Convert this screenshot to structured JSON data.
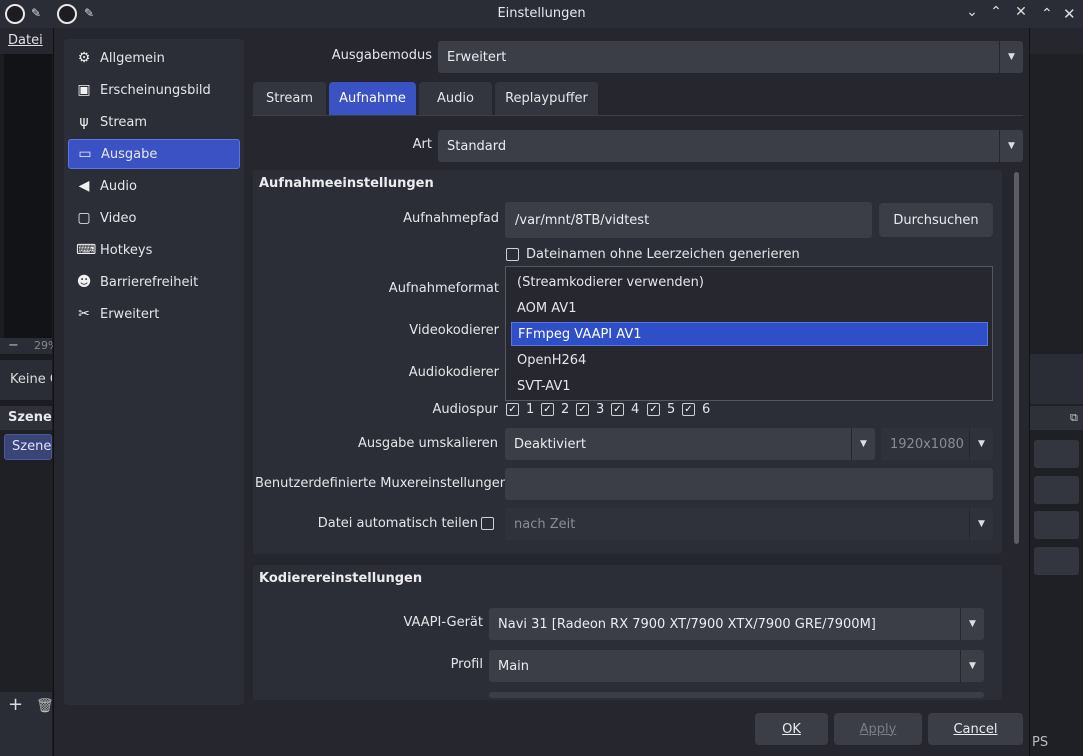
{
  "main_window": {
    "menu_file": "Datei",
    "zoom_minus": "−",
    "zoom_percent": "29%",
    "status_text": "Keine Q",
    "scenes_title": "Szenen",
    "scene_item": "Szene",
    "right_status": "PS"
  },
  "dialog": {
    "title": "Einstellungen",
    "sidebar": {
      "items": [
        {
          "label": "Allgemein",
          "icon": "gear-icon"
        },
        {
          "label": "Erscheinungsbild",
          "icon": "appearance-icon"
        },
        {
          "label": "Stream",
          "icon": "antenna-icon"
        },
        {
          "label": "Ausgabe",
          "icon": "output-icon",
          "active": true
        },
        {
          "label": "Audio",
          "icon": "speaker-icon"
        },
        {
          "label": "Video",
          "icon": "monitor-icon"
        },
        {
          "label": "Hotkeys",
          "icon": "keyboard-icon"
        },
        {
          "label": "Barrierefreiheit",
          "icon": "accessibility-icon"
        },
        {
          "label": "Erweitert",
          "icon": "tools-icon"
        }
      ]
    },
    "output_mode": {
      "label": "Ausgabemodus",
      "value": "Erweitert"
    },
    "tabs": [
      {
        "label": "Stream"
      },
      {
        "label": "Aufnahme",
        "active": true
      },
      {
        "label": "Audio"
      },
      {
        "label": "Replaypuffer"
      }
    ],
    "type": {
      "label": "Art",
      "value": "Standard"
    },
    "recording": {
      "title": "Aufnahmeeinstellungen",
      "path_label": "Aufnahmepfad",
      "path_value": "/var/mnt/8TB/vidtest",
      "browse_label": "Durchsuchen",
      "no_space_label": "Dateinamen ohne Leerzeichen generieren",
      "no_space_checked": false,
      "format_label": "Aufnahmeformat",
      "video_encoder_label": "Videokodierer",
      "audio_encoder_label": "Audiokodierer",
      "audio_track_label": "Audiospur",
      "audio_tracks": [
        {
          "label": "1",
          "checked": true
        },
        {
          "label": "2",
          "checked": true
        },
        {
          "label": "3",
          "checked": true
        },
        {
          "label": "4",
          "checked": true
        },
        {
          "label": "5",
          "checked": true
        },
        {
          "label": "6",
          "checked": true
        }
      ],
      "rescale_label": "Ausgabe umskalieren",
      "rescale_value": "Deaktiviert",
      "rescale_resolution": "1920x1080",
      "muxer_label": "Benutzerdefinierte Muxereinstellungen",
      "muxer_value": "",
      "autosplit_label": "Datei automatisch teilen",
      "autosplit_checked": false,
      "autosplit_value": "nach Zeit"
    },
    "video_encoder_options": [
      {
        "label": "(Streamkodierer verwenden)"
      },
      {
        "label": "AOM AV1"
      },
      {
        "label": "FFmpeg VAAPI AV1",
        "highlighted": true
      },
      {
        "label": "OpenH264"
      },
      {
        "label": "SVT-AV1"
      }
    ],
    "encoder": {
      "title": "Kodierereinstellungen",
      "vaapi_label": "VAAPI-Gerät",
      "vaapi_value": "Navi 31 [Radeon RX 7900 XT/7900 XTX/7900 GRE/7900M]",
      "profile_label": "Profil",
      "profile_value": "Main"
    },
    "buttons": {
      "ok": "OK",
      "apply": "Apply",
      "cancel": "Cancel"
    }
  },
  "colors": {
    "accent": "#3b52c4",
    "highlight": "#2f4fc9",
    "background": "#25262e",
    "panel": "#2c2e37",
    "control": "#3b3d47"
  }
}
